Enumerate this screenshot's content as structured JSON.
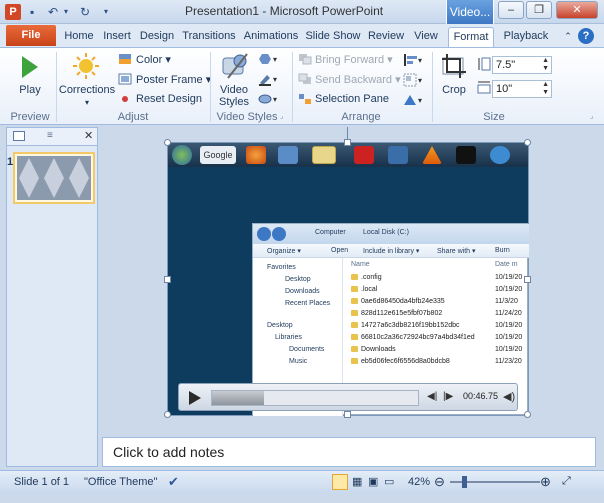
{
  "window": {
    "title": "Presentation1 - Microsoft PowerPoint",
    "contextual_tab_title": "Video...",
    "minimize": "–",
    "restore": "❐",
    "close": "✕"
  },
  "tabs": {
    "file": "File",
    "items": [
      "Home",
      "Insert",
      "Design",
      "Transitions",
      "Animations",
      "Slide Show",
      "Review",
      "View"
    ],
    "format": "Format",
    "playback": "Playback"
  },
  "ribbon": {
    "preview": {
      "play": "Play",
      "label": "Preview"
    },
    "adjust": {
      "corrections": "Corrections",
      "color": "Color",
      "poster_frame": "Poster Frame",
      "reset_design": "Reset Design",
      "label": "Adjust"
    },
    "video_styles": {
      "video_styles": "Video Styles",
      "label": "Video Styles"
    },
    "arrange": {
      "bring_forward": "Bring Forward",
      "send_backward": "Send Backward",
      "selection_pane": "Selection Pane",
      "label": "Arrange"
    },
    "size": {
      "crop": "Crop",
      "height": "7.5\"",
      "width": "10\"",
      "label": "Size"
    }
  },
  "slides_pane": {
    "slide_number": "1"
  },
  "slide": {
    "explorer": {
      "address_computer": "Computer",
      "address_disk": "Local Disk (C:)",
      "toolbar": [
        "Organize ▾",
        "Open",
        "Include in library ▾",
        "Share with ▾",
        "Burn"
      ],
      "nav": [
        "Favorites",
        "Desktop",
        "Downloads",
        "Recent Places",
        "Desktop",
        "Libraries",
        "Documents",
        "Music"
      ],
      "list_header_name": "Name",
      "list_header_date": "Date m",
      "files": [
        {
          "name": ".config",
          "date": "10/19/20"
        },
        {
          "name": ".local",
          "date": "10/19/20"
        },
        {
          "name": "0ae6d86450da4bfb24e335",
          "date": "11/3/20"
        },
        {
          "name": "828d112e615e5fbf07b802",
          "date": "11/24/20"
        },
        {
          "name": "14727a6c3db8216f19bb152dbc",
          "date": "10/19/20"
        },
        {
          "name": "66810c2a36c72924bc97a4bd34f1ed",
          "date": "10/19/20"
        },
        {
          "name": "Downloads",
          "date": "10/19/20"
        },
        {
          "name": "eb5d06fec6f6556d8a0bdcb8",
          "date": "11/23/20"
        }
      ]
    },
    "player": {
      "time": "00:46.75",
      "progress_fraction": 0.25
    },
    "taskbar_search": "Google"
  },
  "notes": {
    "placeholder": "Click to add notes"
  },
  "status": {
    "slide_info": "Slide 1 of 1",
    "theme": "\"Office Theme\"",
    "zoom": "42%"
  },
  "colors": {
    "accent": "#2b579a",
    "file_tab": "#d24726",
    "slide_bg": "#0d3c5e"
  }
}
